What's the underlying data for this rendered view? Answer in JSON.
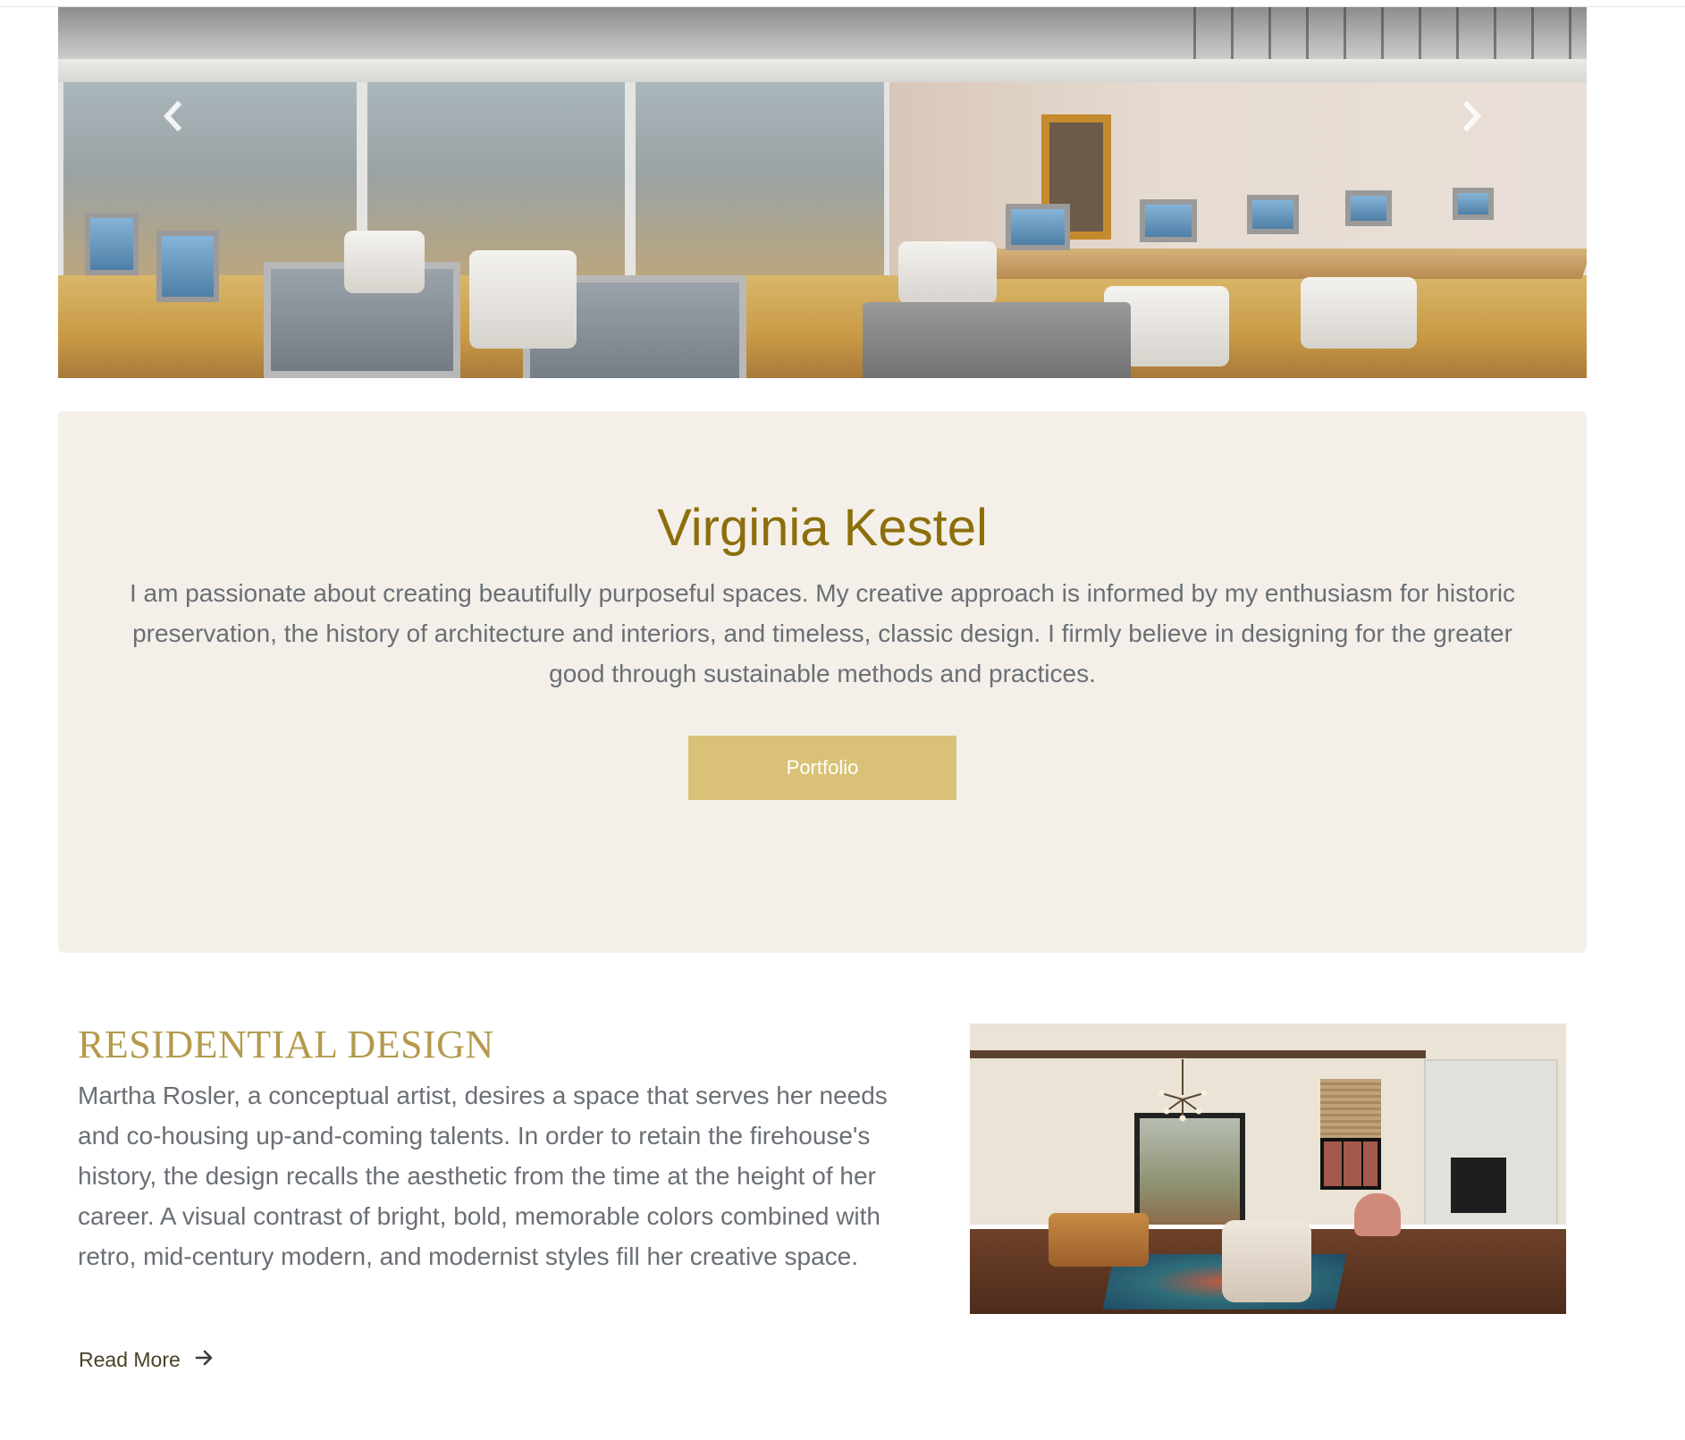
{
  "hero": {
    "image_description": "",
    "prev_icon": "chevron-left-icon",
    "next_icon": "chevron-right-icon"
  },
  "about": {
    "title": "Virginia Kestel",
    "description": "I am passionate about creating beautifully purposeful spaces. My creative approach is informed by my enthusiasm for historic preservation, the history of architecture and interiors, and timeless, classic design. I firmly believe in designing for the greater good through sustainable methods and practices.",
    "button_label": "Portfolio"
  },
  "residential": {
    "title": "RESIDENTIAL DESIGN",
    "description": "Martha Rosler, a conceptual artist, desires a space that serves her needs and co-housing up-and-coming talents. In order to retain the firehouse's history, the design recalls the aesthetic from the time at the height of her career. A visual contrast of bright, bold, memorable colors combined with retro, mid-century modern, and modernist styles fill her creative space.",
    "read_more_label": "Read More",
    "read_more_icon": "arrow-right-icon"
  },
  "colors": {
    "accent_gold": "#8c6f0c",
    "button_gold": "#d9c277",
    "heading_gold": "#b39a4c",
    "card_background": "#f4f0e9",
    "body_text": "#6a6f75"
  }
}
